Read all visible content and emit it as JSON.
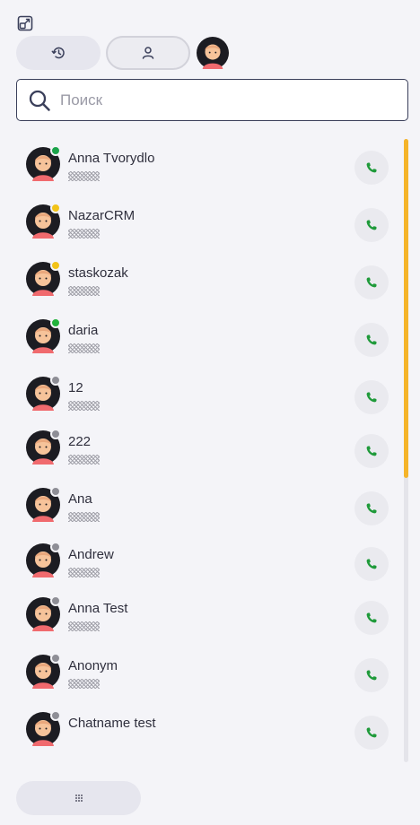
{
  "top": {
    "expand_icon": "expand-icon",
    "tabs": [
      {
        "id": "history",
        "icon": "history-icon",
        "active": false
      },
      {
        "id": "contacts",
        "icon": "person-icon",
        "active": true
      }
    ]
  },
  "search": {
    "placeholder": "Поиск",
    "value": ""
  },
  "contacts": [
    {
      "name": "Anna Tvorydlo",
      "ext": "203",
      "status": "online"
    },
    {
      "name": "NazarCRM",
      "ext": "204",
      "status": "away"
    },
    {
      "name": "staskozak",
      "ext": "205",
      "status": "away"
    },
    {
      "name": "daria",
      "ext": "242",
      "status": "available"
    },
    {
      "name": "12",
      "ext": "210",
      "status": "offline"
    },
    {
      "name": "222",
      "ext": "211",
      "status": "offline"
    },
    {
      "name": "Ana",
      "ext": "212",
      "status": "offline"
    },
    {
      "name": "Andrew",
      "ext": "213",
      "status": "offline"
    },
    {
      "name": "Anna Test",
      "ext": "214",
      "status": "offline"
    },
    {
      "name": "Anonym",
      "ext": "215",
      "status": "offline"
    },
    {
      "name": "Chatname test",
      "ext": "",
      "status": "offline"
    }
  ],
  "colors": {
    "accent_scroll": "#f5b42a",
    "call_green": "#1f9a3a",
    "status_online": "#1aa34a",
    "status_away": "#f2c318",
    "status_offline": "#8e8e96",
    "status_available": "#22b33c"
  },
  "bottom": {
    "dialpad_icon": "dialpad-icon"
  }
}
